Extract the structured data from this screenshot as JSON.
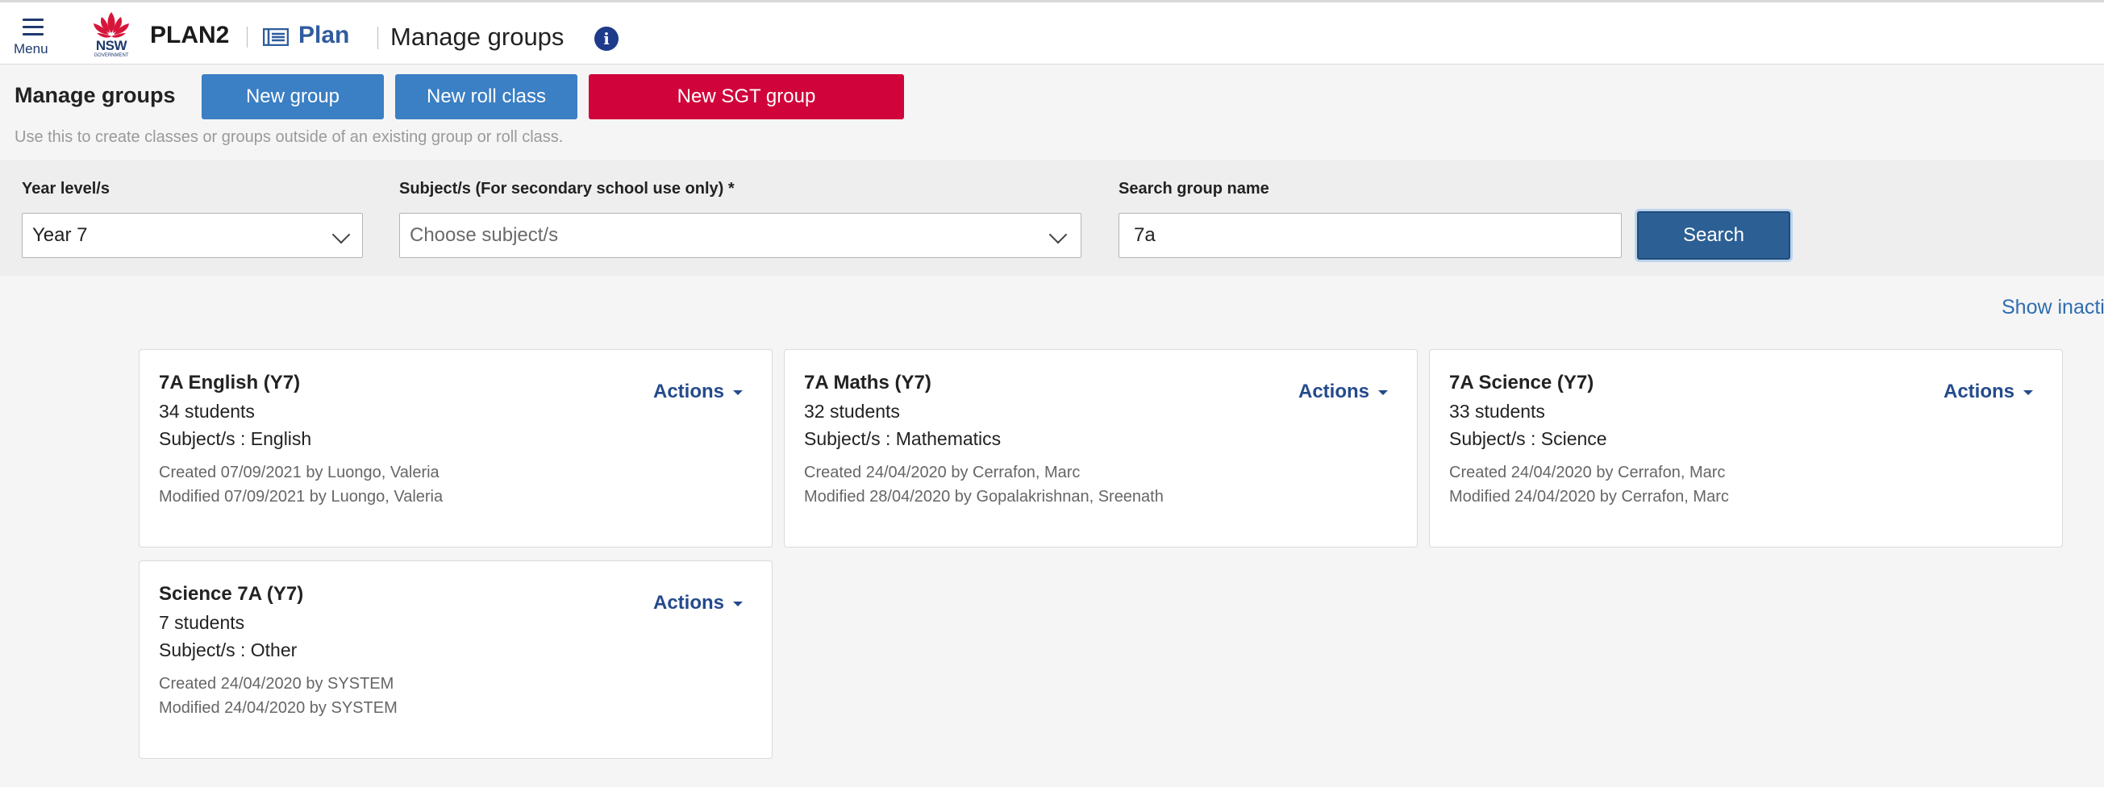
{
  "header": {
    "menu_label": "Menu",
    "logo_text": "NSW",
    "logo_subtext": "GOVERNMENT",
    "app_name": "PLAN2",
    "module_label": "Plan",
    "page_title": "Manage groups",
    "info_glyph": "i"
  },
  "toolbar": {
    "title": "Manage groups",
    "new_group_label": "New group",
    "new_roll_class_label": "New roll class",
    "new_sgt_group_label": "New SGT group",
    "hint": "Use this to create classes or groups outside of an existing group or roll class."
  },
  "filters": {
    "year_label": "Year level/s",
    "year_value": "Year 7",
    "subject_label": "Subject/s (For secondary school use only) *",
    "subject_placeholder": "Choose subject/s",
    "search_label": "Search group name",
    "search_value": "7a",
    "search_button": "Search"
  },
  "show_inactive": "Show inactiv",
  "actions_label": "Actions",
  "groups": [
    {
      "title": "7A English (Y7)",
      "students": "34 students",
      "subjects": "Subject/s : English",
      "created": "Created 07/09/2021 by Luongo, Valeria",
      "modified": "Modified 07/09/2021 by Luongo, Valeria"
    },
    {
      "title": "7A Maths (Y7)",
      "students": "32 students",
      "subjects": "Subject/s : Mathematics",
      "created": "Created 24/04/2020 by Cerrafon, Marc",
      "modified": "Modified 28/04/2020 by Gopalakrishnan, Sreenath"
    },
    {
      "title": "7A Science (Y7)",
      "students": "33 students",
      "subjects": "Subject/s : Science",
      "created": "Created 24/04/2020 by Cerrafon, Marc",
      "modified": "Modified 24/04/2020 by Cerrafon, Marc"
    },
    {
      "title": "Science 7A (Y7)",
      "students": "7 students",
      "subjects": "Subject/s : Other",
      "created": "Created 24/04/2020 by SYSTEM",
      "modified": "Modified 24/04/2020 by SYSTEM"
    }
  ],
  "colors": {
    "primary_blue": "#3b7fc4",
    "sgt_red": "#d0033a",
    "navy": "#1e3a6e",
    "search_blue": "#2c5f94"
  },
  "icons": {
    "menu": "hamburger-icon",
    "logo": "waratah-logo",
    "plan": "plan-icon",
    "info": "info-icon",
    "chevron": "chevron-down-icon",
    "caret": "caret-down-icon"
  }
}
